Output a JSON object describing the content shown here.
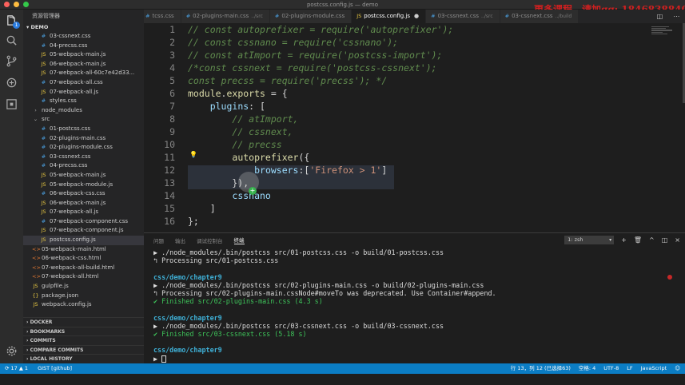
{
  "window": {
    "title": "postcss.config.js — demo"
  },
  "watermark": "更多课程，请加qq: 1846838840",
  "colors": {
    "accent": "#0b7dc4",
    "sidebar_bg": "#252526",
    "editor_bg": "#1e1e1e"
  },
  "sidebar": {
    "title": "资源管理器",
    "section": "DEMO",
    "items": [
      {
        "label": "03-cssnext.css",
        "type": "css",
        "indent": 2
      },
      {
        "label": "04-precss.css",
        "type": "css",
        "indent": 2
      },
      {
        "label": "05-webpack-main.js",
        "type": "js",
        "indent": 2
      },
      {
        "label": "06-webpack-main.js",
        "type": "js",
        "indent": 2
      },
      {
        "label": "07-webpack-all-60c7e42d33...",
        "type": "js",
        "indent": 2
      },
      {
        "label": "07-webpack-all.css",
        "type": "css",
        "indent": 2
      },
      {
        "label": "07-webpack-all.js",
        "type": "js",
        "indent": 2
      },
      {
        "label": "styles.css",
        "type": "css",
        "indent": 2
      },
      {
        "label": "node_modules",
        "type": "folder",
        "indent": 1
      },
      {
        "label": "src",
        "type": "folder-open",
        "indent": 1
      },
      {
        "label": "01-postcss.css",
        "type": "css",
        "indent": 2
      },
      {
        "label": "02-plugins-main.css",
        "type": "css",
        "indent": 2
      },
      {
        "label": "02-plugins-module.css",
        "type": "css",
        "indent": 2
      },
      {
        "label": "03-cssnext.css",
        "type": "css",
        "indent": 2
      },
      {
        "label": "04-precss.css",
        "type": "css",
        "indent": 2
      },
      {
        "label": "05-webpack-main.js",
        "type": "js",
        "indent": 2
      },
      {
        "label": "05-webpack-module.js",
        "type": "js",
        "indent": 2
      },
      {
        "label": "06-webpack-css.css",
        "type": "css",
        "indent": 2
      },
      {
        "label": "06-webpack-main.js",
        "type": "js",
        "indent": 2
      },
      {
        "label": "07-webpack-all.js",
        "type": "js",
        "indent": 2
      },
      {
        "label": "07-webpack-component.css",
        "type": "css",
        "indent": 2
      },
      {
        "label": "07-webpack-component.js",
        "type": "js",
        "indent": 2
      },
      {
        "label": "postcss.config.js",
        "type": "js",
        "indent": 2,
        "selected": true
      },
      {
        "label": "05-webpack-main.html",
        "type": "html",
        "indent": 1
      },
      {
        "label": "06-webpack-css.html",
        "type": "html",
        "indent": 1
      },
      {
        "label": "07-webpack-all-build.html",
        "type": "html",
        "indent": 1
      },
      {
        "label": "07-webpack-all.html",
        "type": "html",
        "indent": 1
      },
      {
        "label": "gulpfile.js",
        "type": "js",
        "indent": 1
      },
      {
        "label": "package.json",
        "type": "json",
        "indent": 1
      },
      {
        "label": "webpack.config.js",
        "type": "js",
        "indent": 1
      }
    ],
    "outline": [
      "DOCKER",
      "BOOKMARKS",
      "COMMITS",
      "COMPARE COMMITS",
      "LOCAL HISTORY"
    ]
  },
  "tabs": [
    {
      "label": "tcss.css",
      "desc": "",
      "icon": "css"
    },
    {
      "label": "02-plugins-main.css",
      "desc": "../src",
      "icon": "css"
    },
    {
      "label": "02-plugins-module.css",
      "desc": "",
      "icon": "css"
    },
    {
      "label": "postcss.config.js",
      "desc": "",
      "icon": "js",
      "active": true,
      "dirty": "●"
    },
    {
      "label": "03-cssnext.css",
      "desc": "../src",
      "icon": "css"
    },
    {
      "label": "03-cssnext.css",
      "desc": "../build",
      "icon": "css"
    }
  ],
  "editor": {
    "lines": [
      {
        "n": "1",
        "parts": [
          [
            "cm",
            "// const autoprefixer = require('autoprefixer');"
          ]
        ]
      },
      {
        "n": "2",
        "parts": [
          [
            "cm",
            "// const cssnano = require('cssnano');"
          ]
        ]
      },
      {
        "n": "3",
        "parts": [
          [
            "cm",
            "// const atImport = require('postcss-import');"
          ]
        ]
      },
      {
        "n": "4",
        "parts": [
          [
            "cm",
            "/*const cssnext = require('postcss-cssnext');"
          ]
        ]
      },
      {
        "n": "5",
        "parts": [
          [
            "cm",
            "const precss = require('precss'); */"
          ]
        ]
      },
      {
        "n": "6",
        "parts": [
          [
            "kw",
            "module"
          ],
          [
            "pl",
            "."
          ],
          [
            "kw",
            "exports"
          ],
          [
            "pl",
            " = {"
          ]
        ]
      },
      {
        "n": "7",
        "parts": [
          [
            "pl",
            "    "
          ],
          [
            "prop",
            "plugins"
          ],
          [
            "pl",
            ": ["
          ]
        ]
      },
      {
        "n": "8",
        "parts": [
          [
            "pl",
            "        "
          ],
          [
            "cm",
            "// atImport,"
          ]
        ]
      },
      {
        "n": "9",
        "parts": [
          [
            "pl",
            "        "
          ],
          [
            "cm",
            "// cssnext,"
          ]
        ]
      },
      {
        "n": "10",
        "parts": [
          [
            "pl",
            "        "
          ],
          [
            "cm",
            "// precss"
          ]
        ]
      },
      {
        "n": "11",
        "parts": [
          [
            "pl",
            "        "
          ],
          [
            "kw",
            "autoprefixer"
          ],
          [
            "pl",
            "({"
          ]
        ]
      },
      {
        "n": "12",
        "parts": [
          [
            "pl",
            "            "
          ],
          [
            "prop",
            "browsers"
          ],
          [
            "pl",
            ":["
          ],
          [
            "str",
            "'Firefox > 1'"
          ],
          [
            "pl",
            "]"
          ]
        ]
      },
      {
        "n": "13",
        "parts": [
          [
            "pl",
            "        }),"
          ]
        ]
      },
      {
        "n": "14",
        "parts": [
          [
            "pl",
            "        "
          ],
          [
            "prop",
            "cssnano"
          ]
        ]
      },
      {
        "n": "15",
        "parts": [
          [
            "pl",
            "    ]"
          ]
        ]
      },
      {
        "n": "16",
        "parts": [
          [
            "pl",
            "};"
          ]
        ]
      }
    ]
  },
  "panel": {
    "tabs": [
      "问题",
      "输出",
      "调试控制台",
      "终端"
    ],
    "active_tab": 3,
    "terminal_select": "1: zsh",
    "terminal": [
      [
        [
          "w",
          "▶ ./node_modules/.bin/postcss src/01-postcss.css -o build/01-postcss.css"
        ]
      ],
      [
        [
          "w",
          "↰ Processing src/01-postcss.css"
        ]
      ],
      [
        [
          "w",
          ""
        ]
      ],
      [
        [
          "c",
          "css/demo/chapter9"
        ]
      ],
      [
        [
          "w",
          "▶ ./node_modules/.bin/postcss src/02-plugins-main.css -o build/02-plugins-main.css"
        ]
      ],
      [
        [
          "w",
          "↰ Processing src/02-plugins-main.cssNode#moveTo was deprecated. Use Container#append."
        ]
      ],
      [
        [
          "g",
          "✔ Finished src/02-plugins-main.css (4.3 s)"
        ]
      ],
      [
        [
          "w",
          ""
        ]
      ],
      [
        [
          "c",
          "css/demo/chapter9"
        ]
      ],
      [
        [
          "w",
          "▶ ./node_modules/.bin/postcss src/03-cssnext.css -o build/03-cssnext.css"
        ]
      ],
      [
        [
          "g",
          "✔ Finished src/03-cssnext.css (5.18 s)"
        ]
      ],
      [
        [
          "w",
          ""
        ]
      ],
      [
        [
          "c",
          "css/demo/chapter9"
        ]
      ],
      [
        [
          "w",
          "▶ "
        ]
      ]
    ]
  },
  "statusbar": {
    "sync": "⟳ 17 ▲ 1",
    "git": "GIST [github]",
    "position": "行 13，列 12 (已选择63)",
    "spaces": "空格: 4",
    "encoding": "UTF-8",
    "eol": "LF",
    "language": "JavaScript"
  }
}
